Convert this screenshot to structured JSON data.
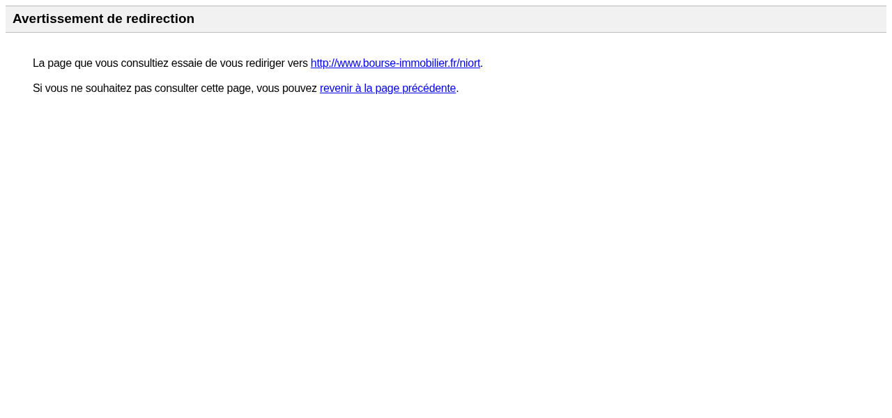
{
  "header": {
    "title": "Avertissement de redirection"
  },
  "paragraphs": [
    {
      "text_before": "La page que vous consultiez essaie de vous rediriger vers ",
      "link": "http://www.bourse-immobilier.fr/niort",
      "text_after": "."
    },
    {
      "text_before": "Si vous ne souhaitez pas consulter cette page, vous pouvez ",
      "link": "revenir à la page précédente",
      "text_after": "."
    }
  ]
}
